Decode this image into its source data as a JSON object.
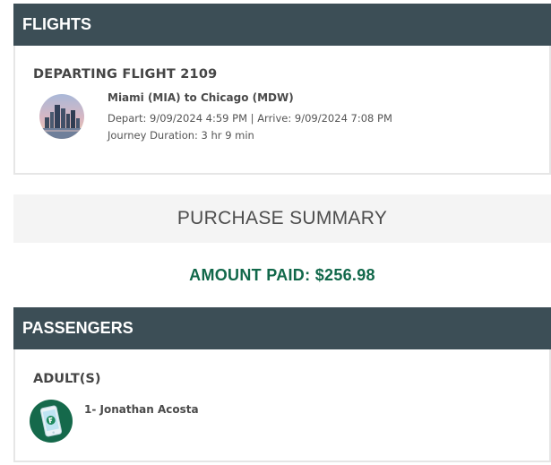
{
  "flights": {
    "header": "FLIGHTS",
    "departing_title": "DEPARTING FLIGHT 2109",
    "route": "Miami (MIA) to Chicago (MDW)",
    "times": "Depart: 9/09/2024 4:59 PM | Arrive: 9/09/2024 7:08 PM",
    "duration": "Journey Duration: 3 hr 9 min",
    "image_icon": "city-skyline-icon"
  },
  "summary": {
    "title": "PURCHASE SUMMARY",
    "amount_paid": "AMOUNT PAID: $256.98"
  },
  "passengers": {
    "header": "PASSENGERS",
    "group_label": "ADULT(S)",
    "list": [
      {
        "name": "1- Jonathan Acosta",
        "icon": "mobile-phone-icon"
      }
    ]
  },
  "colors": {
    "header_bg": "#3c4e56",
    "amount_green": "#11684a",
    "avatar_green": "#15694b",
    "summary_bg": "#f4f4f4"
  }
}
